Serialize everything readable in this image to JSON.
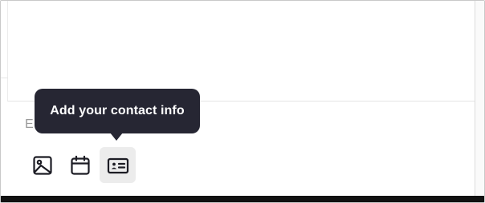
{
  "editor": {
    "placeholder_fragment": "E"
  },
  "tooltip": {
    "text": "Add your contact info"
  },
  "toolbar": {
    "buttons": [
      {
        "icon": "image-icon",
        "active": false
      },
      {
        "icon": "calendar-icon",
        "active": false
      },
      {
        "icon": "contact-card-icon",
        "active": true
      }
    ]
  },
  "colors": {
    "tooltip_bg": "#262633",
    "active_button_bg": "#ececec",
    "icon_stroke": "#1c1c24"
  }
}
